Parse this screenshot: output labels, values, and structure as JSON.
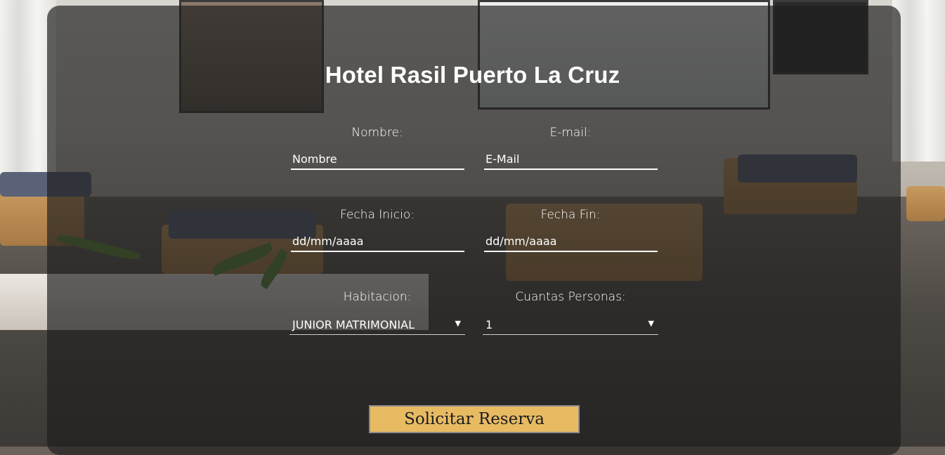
{
  "hotel_title": "Hotel Rasil Puerto La Cruz",
  "form": {
    "nombre_label": "Nombre:",
    "nombre_placeholder": "Nombre",
    "email_label": "E-mail:",
    "email_placeholder": "E-Mail",
    "fecha_inicio_label": "Fecha Inicio:",
    "fecha_inicio_placeholder": "dd/mm/aaaa",
    "fecha_fin_label": "Fecha Fin:",
    "fecha_fin_placeholder": "dd/mm/aaaa",
    "habitacion_label": "Habitacion:",
    "habitacion_value": "JUNIOR MATRIMONIAL",
    "personas_label": "Cuantas Personas:",
    "personas_value": "1",
    "submit_label": "Solicitar Reserva"
  },
  "colors": {
    "overlay": "#1e1e1e",
    "button": "#e8bb63",
    "text": "#ffffff"
  },
  "icons": {
    "dropdown": "triangle-down"
  }
}
